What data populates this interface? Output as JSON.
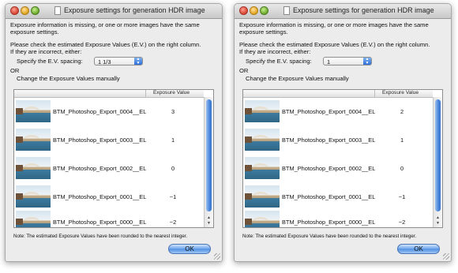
{
  "dialogs": [
    {
      "title": "Exposure settings for generation HDR image",
      "message_line1": "Exposure information is missing, or one or more images have the same",
      "message_line2": "exposure settings.",
      "instruction_line1": "Please check the estimated Exposure Values (E.V.) on the right column.",
      "instruction_line2": "If they are incorrect, either:",
      "spacing_label": "Specify the E.V. spacing:",
      "spacing_value": "1 1/3",
      "or_label": "OR",
      "manual_label": "Change the Exposure Values manually",
      "column_header": "Exposure Value",
      "rows": [
        {
          "file": "BTM_Photoshop_Export_0004__ELI4",
          "ev": "3"
        },
        {
          "file": "BTM_Photoshop_Export_0003__ELI4",
          "ev": "1"
        },
        {
          "file": "BTM_Photoshop_Export_0002__ELI4",
          "ev": "0"
        },
        {
          "file": "BTM_Photoshop_Export_0001__ELI4",
          "ev": "−1"
        },
        {
          "file": "BTM_Photoshop_Export_0000__ELI4",
          "ev": "−2"
        }
      ],
      "note": "Note: The estimated Exposure Values have been rounded to the nearest integer.",
      "ok_label": "OK"
    },
    {
      "title": "Exposure settings for generation HDR image",
      "message_line1": "Exposure information is missing, or one or more images have the same",
      "message_line2": "exposure settings.",
      "instruction_line1": "Please check the estimated Exposure Values (E.V.) on the right column.",
      "instruction_line2": "If they are incorrect, either:",
      "spacing_label": "Specify the E.V. spacing:",
      "spacing_value": "1",
      "or_label": "OR",
      "manual_label": "Change the Exposure Values manually",
      "column_header": "Exposure Value",
      "rows": [
        {
          "file": "BTM_Photoshop_Export_0004__ELI4",
          "ev": "2"
        },
        {
          "file": "BTM_Photoshop_Export_0003__ELI4",
          "ev": "1"
        },
        {
          "file": "BTM_Photoshop_Export_0002__ELI4",
          "ev": "0"
        },
        {
          "file": "BTM_Photoshop_Export_0001__ELI4",
          "ev": "−1"
        },
        {
          "file": "BTM_Photoshop_Export_0000__ELI4",
          "ev": "−2"
        }
      ],
      "note": "Note: The estimated Exposure Values have been rounded to the nearest integer.",
      "ok_label": "OK"
    }
  ],
  "colors": {
    "window_bg": "#ececec",
    "ok_button_accent": "#4f8fe3",
    "scrollbar_accent": "#4a86dd"
  }
}
